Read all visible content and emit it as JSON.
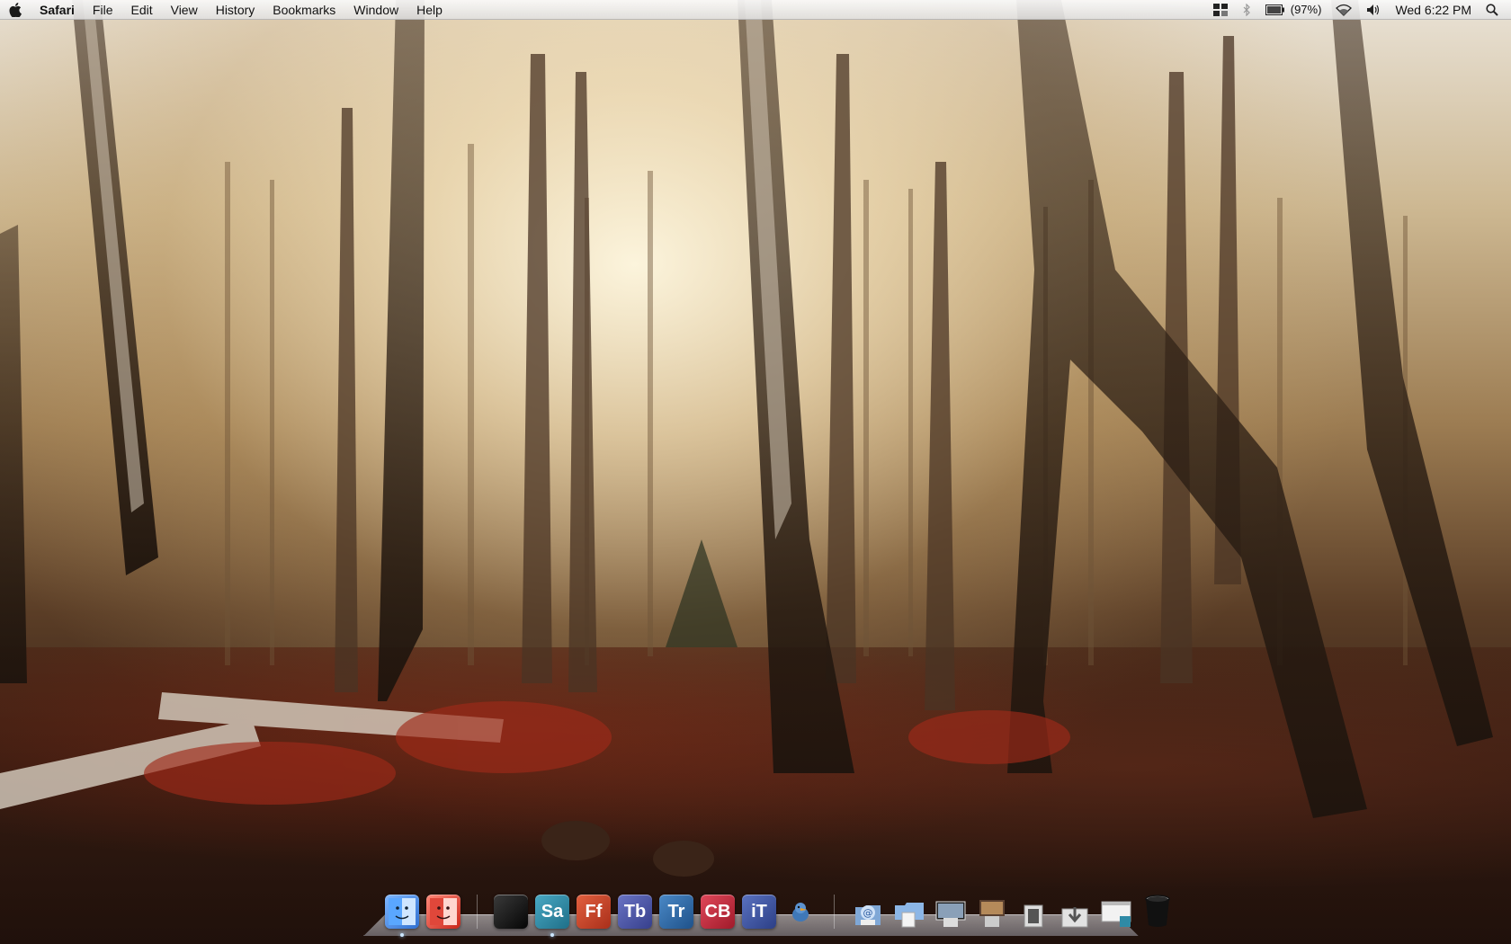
{
  "menubar": {
    "app_name": "Safari",
    "menus": [
      "File",
      "Edit",
      "View",
      "History",
      "Bookmarks",
      "Window",
      "Help"
    ],
    "battery": "(97%)",
    "clock": "Wed 6:22 PM"
  },
  "dock": {
    "apps": [
      {
        "label": "",
        "icon": "finder-icon",
        "color": "#3a7bd5"
      },
      {
        "label": "",
        "icon": "finder-alt-icon",
        "color": "#d33a2c"
      },
      {
        "label": "",
        "icon": "terminal-icon",
        "color": "#111111"
      },
      {
        "label": "Sa",
        "icon": "safari-icon",
        "color": "#2f8aa6"
      },
      {
        "label": "Ff",
        "icon": "firefox-icon",
        "color": "#c8432a"
      },
      {
        "label": "Tb",
        "icon": "thunderbird-icon",
        "color": "#4b56a8"
      },
      {
        "label": "Tr",
        "icon": "transmission-icon",
        "color": "#2c6aa8"
      },
      {
        "label": "CB",
        "icon": "cyberduck-icon",
        "color": "#c42a3a"
      },
      {
        "label": "iT",
        "icon": "itunes-icon",
        "color": "#3e55a0"
      },
      {
        "label": "",
        "icon": "bird-icon",
        "color": "#4a7fb8"
      }
    ],
    "stacks": [
      {
        "icon": "applications-stack-icon"
      },
      {
        "icon": "documents-stack-icon"
      },
      {
        "icon": "screenshots-stack-icon"
      },
      {
        "icon": "pictures-stack-icon"
      },
      {
        "icon": "movies-stack-icon"
      },
      {
        "icon": "downloads-stack-icon"
      },
      {
        "icon": "safari-window-stack-icon"
      },
      {
        "icon": "trash-icon"
      }
    ]
  }
}
